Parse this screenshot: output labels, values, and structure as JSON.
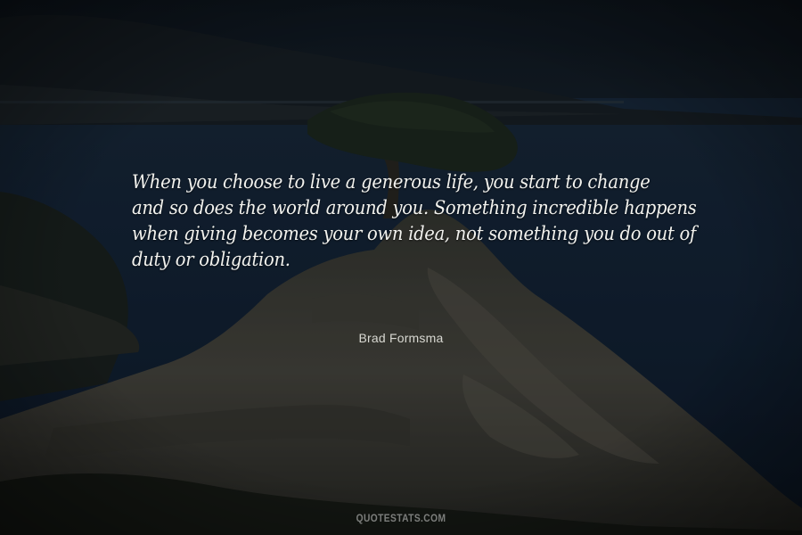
{
  "quote": {
    "lines": [
      "When you choose to live a generous life, you start to change",
      "and so does the world around you. Something incredible happens",
      "when giving becomes your own idea, not something you do out of",
      "duty or obligation."
    ]
  },
  "author": "Brad Formsma",
  "watermark": "QUOTESTATS.COM",
  "colors": {
    "sky": "#101c27",
    "sea": "#13243a",
    "rock": "#4a4a44",
    "quote_text": "#f2f2ee"
  }
}
